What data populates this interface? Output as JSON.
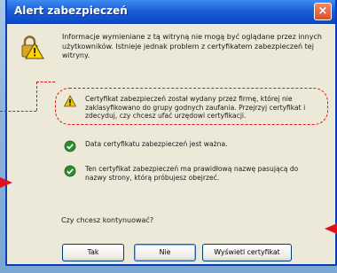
{
  "window": {
    "title": "Alert zabezpieczeń",
    "close_label": "×"
  },
  "intro_text": "Informacje wymieniane z tą witryną nie mogą być oglądane przez innych użytkowników. Istnieje jednak problem z certyfikatem zabezpieczeń tej witryny.",
  "items": [
    {
      "icon": "warning-icon",
      "text": "Certyfikat zabezpieczeń został wydany przez firmę, której nie zaklasyfikowano do grupy godnych zaufania. Przejrzyj certyfikat i zdecyduj, czy chcesz ufać urzędowi certyfikacji."
    },
    {
      "icon": "check-icon",
      "text": "Data certyfikatu zabezpieczeń jest ważna."
    },
    {
      "icon": "check-icon",
      "text": "Ten certyfikat zabezpieczeń ma prawidłową nazwę pasującą do nazwy strony, którą próbujesz obejrzeć."
    }
  ],
  "question": "Czy chcesz kontynuować?",
  "buttons": {
    "yes": "Tak",
    "no": "Nie",
    "view": "Wyświetl certyfikat"
  },
  "colors": {
    "title_bar": "#1e5fd6",
    "highlight": "#e0101e",
    "dialog_bg": "#ece9d8",
    "ok": "#2e8b2e",
    "warning": "#f2c400"
  }
}
